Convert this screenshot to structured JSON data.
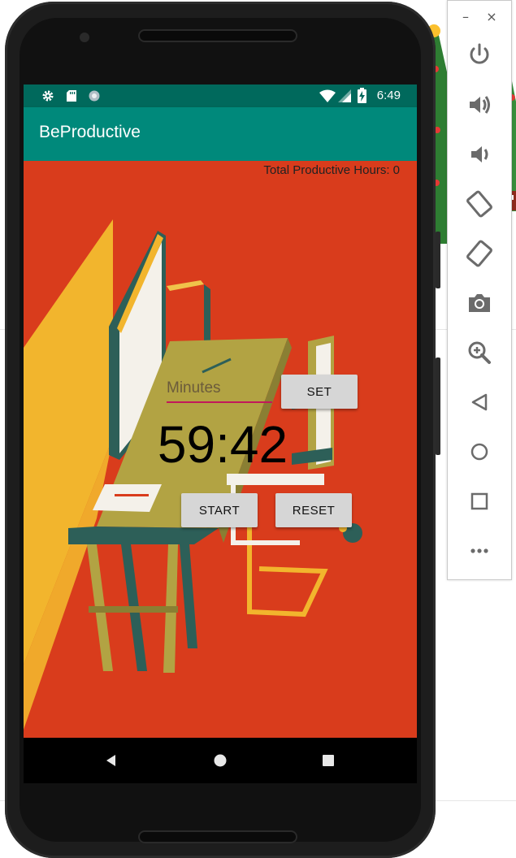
{
  "status_bar": {
    "time": "6:49"
  },
  "app": {
    "title": "BeProductive"
  },
  "main": {
    "total_hours_label": "Total Productive Hours: 0",
    "minutes_placeholder": "Minutes",
    "set_label": "SET",
    "timer_display": "59:42",
    "start_label": "START",
    "reset_label": "RESET"
  },
  "nav": [
    "back-icon",
    "home-icon",
    "recents-icon"
  ],
  "emulator_toolbar": {
    "minimize": "–",
    "close": "×",
    "buttons": [
      "power-icon",
      "volume-up-icon",
      "volume-down-icon",
      "rotate-left-icon",
      "rotate-right-icon",
      "camera-icon",
      "zoom-icon",
      "back-icon",
      "home-icon",
      "overview-icon",
      "more-icon"
    ]
  },
  "colors": {
    "status_bar": "#00695c",
    "app_bar": "#00897b",
    "background": "#d93c1c",
    "accent": "#c2185b"
  }
}
